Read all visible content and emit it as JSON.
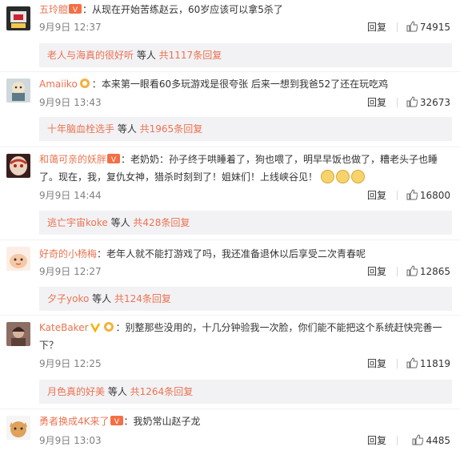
{
  "comments": [
    {
      "user": "五玲膻",
      "badge": "icon",
      "sep": "：",
      "text": "从现在开始苦练赵云，60岁应该可以拿5杀了",
      "time": "9月9日 12:37",
      "reply": "回复",
      "likes": "74915",
      "sub": {
        "name": "老人与海真的很好听",
        "mid": " 等人 ",
        "total": "共1117条回复"
      }
    },
    {
      "user": "Amaiiko",
      "badge": "icon",
      "sep": "：",
      "text": "本来第一眼看60多玩游戏是很夸张 后来一想到我爸52了还在玩吃鸡",
      "time": "9月9日 13:43",
      "reply": "回复",
      "likes": "32673",
      "sub": {
        "name": "十年脑血栓选手",
        "mid": " 等人 ",
        "total": "共1965条回复"
      }
    },
    {
      "user": "和蔼可亲的妖胖",
      "badge": "icon",
      "sep": "：",
      "text": "老奶奶：孙子终于哄睡着了，狗也喂了，明早早饭也做了，糟老头子也睡了。现在，我，复仇女神，猎杀时刻到了！姐妹们！上线峡谷见！",
      "time": "9月9日 14:44",
      "reply": "回复",
      "likes": "16800",
      "sub": {
        "name": "逃亡宇宙koke",
        "mid": " 等人 ",
        "total": "共428条回复"
      }
    },
    {
      "user": "好奇的小杨梅",
      "badge": "",
      "sep": "：",
      "text": "老年人就不能打游戏了吗，我还准备退休以后享受二次青春呢",
      "time": "9月9日 12:27",
      "reply": "回复",
      "likes": "12865",
      "sub": {
        "name": "夕子yoko",
        "mid": " 等人 ",
        "total": "共124条回复"
      }
    },
    {
      "user": "KateBaker",
      "badge": "icon",
      "sep": "：",
      "text": "别整那些没用的，十几分钟验我一次脸，你们能不能把这个系统赶快完善一下？",
      "time": "9月9日 12:25",
      "reply": "回复",
      "likes": "11819",
      "sub": {
        "name": "月色真的好美",
        "mid": " 等人 ",
        "total": "共1264条回复"
      }
    },
    {
      "user": "勇者换成4K来了",
      "badge": "icon",
      "sep": "：",
      "text": "我奶常山赵子龙",
      "time": "9月9日 13:03",
      "reply": "回复",
      "likes": "4485",
      "sub": null
    }
  ],
  "colors": {
    "username": "#eb7350",
    "meta": "#808080",
    "subbox_bg": "#f2f2f5"
  }
}
